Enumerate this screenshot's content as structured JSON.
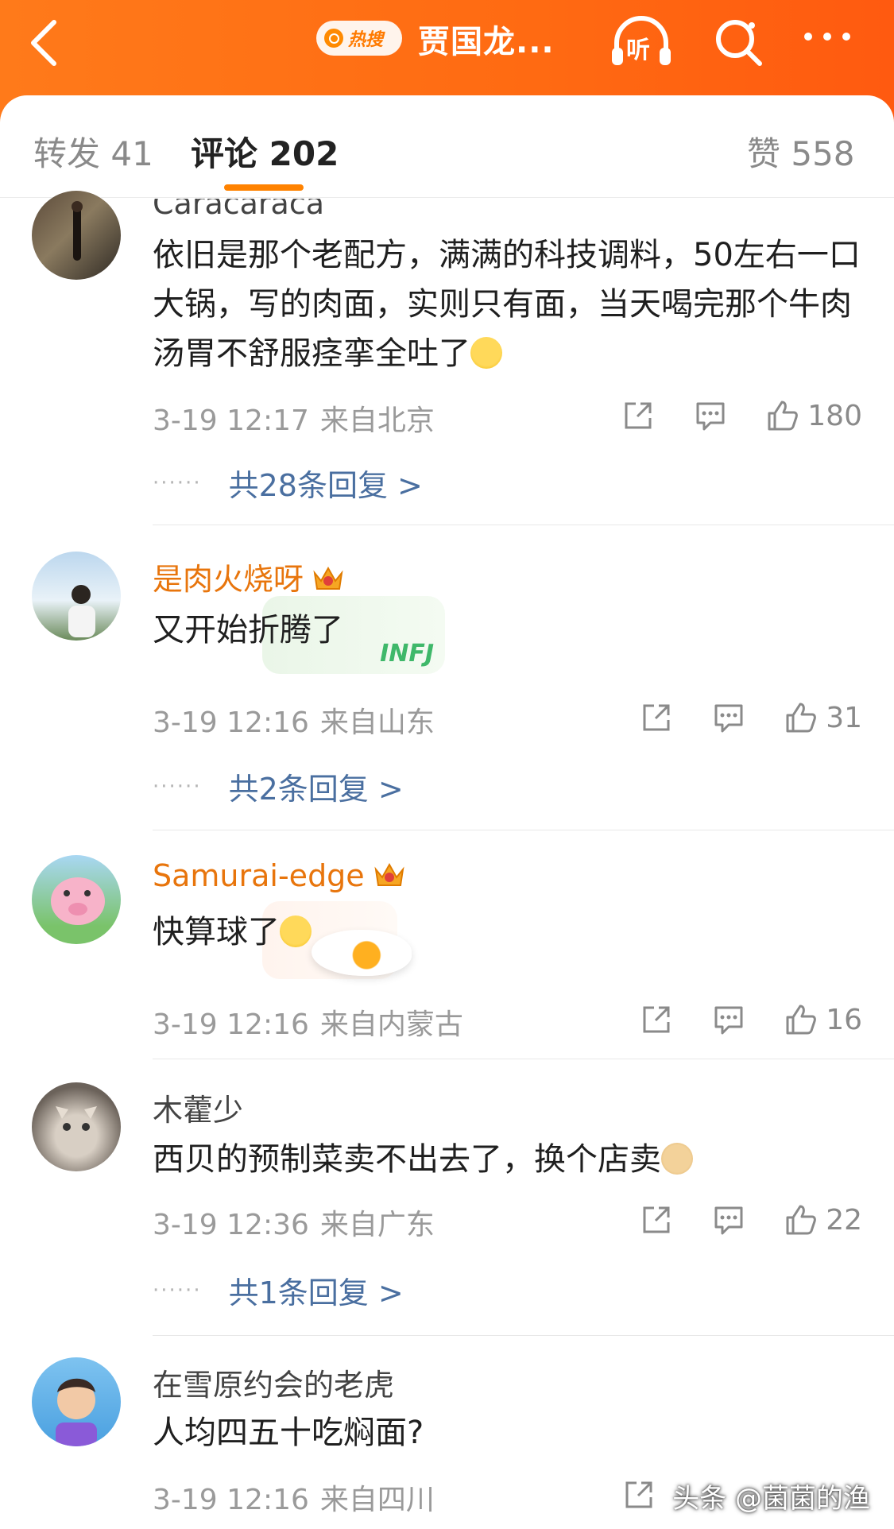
{
  "header": {
    "hot_badge": "热搜",
    "topic": "贾国龙...",
    "listen_label": "听"
  },
  "tabs": {
    "repost": "转发 41",
    "comments": "评论 202",
    "likes": "赞 558"
  },
  "comments": [
    {
      "user": "Caracaraca",
      "text": "依旧是那个老配方，满满的科技调料，50左右一口大锅，写的肉面，实则只有面，当天喝完那个牛肉汤胃不舒服痉挛全吐了",
      "time": "3-19 12:17",
      "location": "来自北京",
      "likes": "180",
      "replies": "共28条回复 >"
    },
    {
      "user": "是肉火烧呀",
      "text": "又开始折腾了",
      "time": "3-19 12:16",
      "location": "来自山东",
      "likes": "31",
      "replies": "共2条回复 >",
      "sticker_text": "INFJ"
    },
    {
      "user": "Samurai-edge",
      "text": "快算球了",
      "time": "3-19 12:16",
      "location": "来自内蒙古",
      "likes": "16"
    },
    {
      "user": "木藿少",
      "text": "西贝的预制菜卖不出去了，换个店卖",
      "time": "3-19 12:36",
      "location": "来自广东",
      "likes": "22",
      "replies": "共1条回复 >"
    },
    {
      "user": "在雪原约会的老虎",
      "text": "人均四五十吃焖面?",
      "time": "3-19 12:16",
      "location": "来自四川"
    }
  ],
  "watermark": "头条 @菌菌的渔",
  "colors": {
    "header": "#ff6a12",
    "accent": "#ff8200",
    "vip_name": "#e8750c",
    "reply_link": "#4a6fa0"
  }
}
